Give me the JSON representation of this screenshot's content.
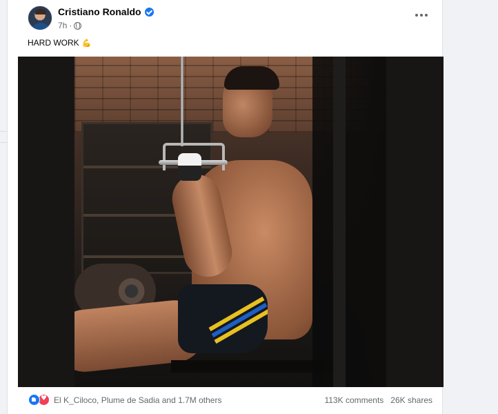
{
  "post": {
    "author_name": "Cristiano Ronaldo",
    "timestamp": "7h",
    "audience_icon": "globe-icon",
    "verified_icon": "verified-badge-icon",
    "caption_text": "HARD WORK",
    "caption_emoji": "💪",
    "image_alt": "Man doing cable row exercise in gym"
  },
  "footer": {
    "reaction_icons": [
      "like-icon",
      "love-icon"
    ],
    "reactions_summary": "El K_Ciloco, Plume de Sadia and 1.7M others",
    "comments": "113K comments",
    "shares": "26K shares"
  },
  "colors": {
    "accent_blue": "#1877f2",
    "love_red": "#f33e58",
    "secondary_text": "#65676b",
    "page_background": "#f0f2f5"
  }
}
